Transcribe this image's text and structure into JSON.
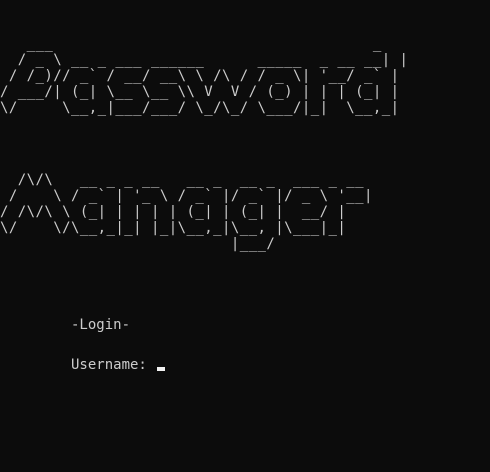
{
  "banner": {
    "word_1": "Password",
    "word_2": "Manager",
    "ascii_1": "   ___                                    _ \n  / _ \\ __ _ ___ ______      _____  _ __ __| |\n / /_)// _` / __/ __\\ \\ /\\ / / _ \\| '__/ _` |\n/ ___/| (_| \\__ \\__ \\\\ V  V / (_) | | | (_| |\n\\/     \\__,_|___/___/ \\_/\\_/ \\___/|_|  \\__,_|",
    "ascii_2": "  /\\/\\   __ _ _ __   __ _  __ _  ___ _ __ \n /    \\ / _` | '_ \\ / _` |/ _` |/ _ \\ '__|\n/ /\\/\\ \\ (_| | | | | (_| | (_| |  __/ |   \n\\/    \\/\\__,_|_| |_|\\__,_|\\__, |\\___|_|   \n                          |___/           "
  },
  "login": {
    "header": "-Login-",
    "username_label": "Username: "
  },
  "colors": {
    "background": "#0c0c0c",
    "text": "#cccccc",
    "cursor": "#f2f2f2"
  }
}
